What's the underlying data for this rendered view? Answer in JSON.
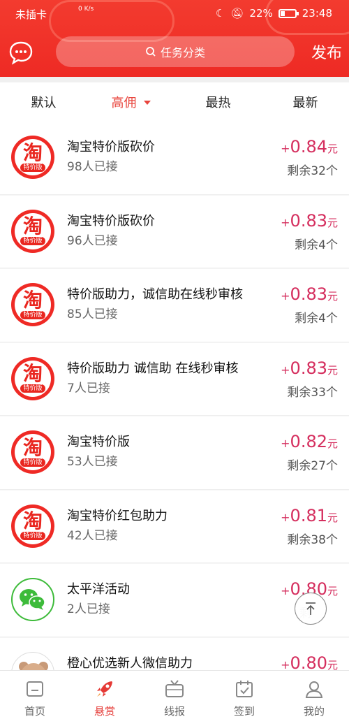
{
  "status_bar": {
    "carrier": "未插卡",
    "net_speed": "0 K/s",
    "battery": "22%",
    "time": "23:48"
  },
  "header": {
    "search_placeholder": "任务分类",
    "publish_label": "发布",
    "chat_icon": "chat-bubble-icon"
  },
  "tabs": [
    {
      "label": "默认"
    },
    {
      "label": "高佣"
    },
    {
      "label": "最热"
    },
    {
      "label": "最新"
    }
  ],
  "tasks": [
    {
      "icon": "taobao-tejia-icon",
      "logo_text": "淘",
      "logo_sub": "特价版",
      "title": "淘宝特价版砍价",
      "count": "98人已接",
      "plus": "+",
      "price": "0.84",
      "unit": "元",
      "remain": "剩余32个"
    },
    {
      "icon": "taobao-tejia-icon",
      "logo_text": "淘",
      "logo_sub": "特价版",
      "title": "淘宝特价版砍价",
      "count": "96人已接",
      "plus": "+",
      "price": "0.83",
      "unit": "元",
      "remain": "剩余4个"
    },
    {
      "icon": "taobao-tejia-icon",
      "logo_text": "淘",
      "logo_sub": "特价版",
      "title": "特价版助力，诚信助在线秒审核",
      "count": "85人已接",
      "plus": "+",
      "price": "0.83",
      "unit": "元",
      "remain": "剩余4个"
    },
    {
      "icon": "taobao-tejia-icon",
      "logo_text": "淘",
      "logo_sub": "特价版",
      "title": "特价版助力 诚信助 在线秒审核",
      "count": "7人已接",
      "plus": "+",
      "price": "0.83",
      "unit": "元",
      "remain": "剩余33个"
    },
    {
      "icon": "taobao-tejia-icon",
      "logo_text": "淘",
      "logo_sub": "特价版",
      "title": "淘宝特价版",
      "count": "53人已接",
      "plus": "+",
      "price": "0.82",
      "unit": "元",
      "remain": "剩余27个"
    },
    {
      "icon": "taobao-tejia-icon",
      "logo_text": "淘",
      "logo_sub": "特价版",
      "title": "淘宝特价红包助力",
      "count": "42人已接",
      "plus": "+",
      "price": "0.81",
      "unit": "元",
      "remain": "剩余38个"
    },
    {
      "icon": "wechat-icon",
      "title": "太平洋活动",
      "count": "2人已接",
      "plus": "+",
      "price": "0.80",
      "unit": "元",
      "remain": "剩"
    },
    {
      "icon": "bear-avatar-icon",
      "title": "橙心优选新人微信助力",
      "count": "",
      "plus": "+",
      "price": "0.80",
      "unit": "元",
      "remain": ""
    }
  ],
  "bottom_nav": [
    {
      "label": "首页",
      "icon": "home-icon"
    },
    {
      "label": "悬赏",
      "icon": "rocket-icon"
    },
    {
      "label": "线报",
      "icon": "tv-icon"
    },
    {
      "label": "签到",
      "icon": "calendar-check-icon"
    },
    {
      "label": "我的",
      "icon": "user-icon"
    }
  ],
  "colors": {
    "header_red": "#ee2a24",
    "accent": "#e8453d",
    "price": "#d52e5e"
  }
}
